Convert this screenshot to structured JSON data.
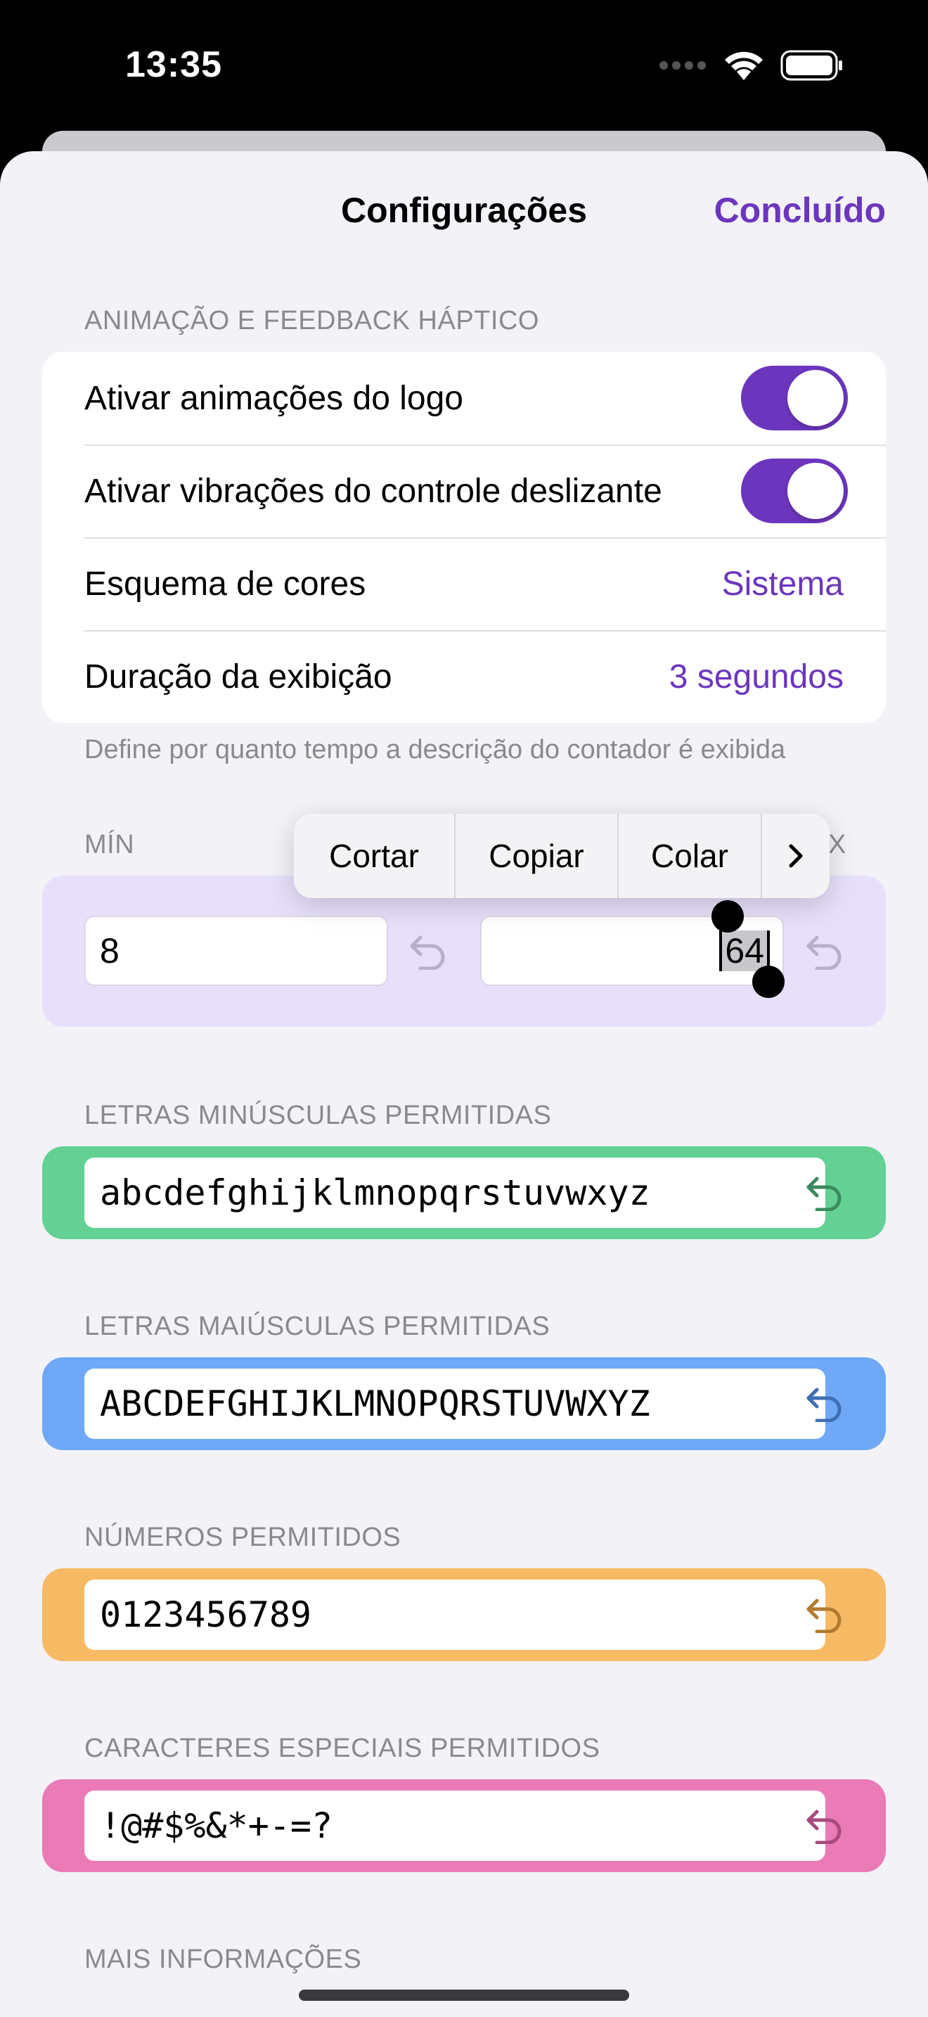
{
  "status_bar": {
    "time": "13:35"
  },
  "nav": {
    "title": "Configurações",
    "done_label": "Concluído"
  },
  "animation_section": {
    "header": "ANIMAÇÃO E FEEDBACK HÁPTICO",
    "rows": [
      {
        "label": "Ativar animações do logo",
        "toggle_on": true
      },
      {
        "label": "Ativar vibrações do controle deslizante",
        "toggle_on": true
      },
      {
        "label": "Esquema de cores",
        "value": "Sistema"
      },
      {
        "label": "Duração da exibição",
        "value": "3 segundos"
      }
    ],
    "footer": "Define por quanto tempo a descrição do contador é exibida"
  },
  "length_section": {
    "min_header": "MÍN",
    "max_header": "MÁX",
    "min_value": "8",
    "max_value": "64"
  },
  "context_menu": {
    "items": [
      "Cortar",
      "Copiar",
      "Colar"
    ]
  },
  "lowercase_section": {
    "header": "LETRAS MINÚSCULAS PERMITIDAS",
    "value": "abcdefghijklmnopqrstuvwxyz",
    "color": "#63d194"
  },
  "uppercase_section": {
    "header": "LETRAS MAIÚSCULAS PERMITIDAS",
    "value": "ABCDEFGHIJKLMNOPQRSTUVWXYZ",
    "color": "#6ea8f7"
  },
  "numbers_section": {
    "header": "NÚMEROS PERMITIDOS",
    "value": "0123456789",
    "color": "#f7ba64"
  },
  "special_section": {
    "header": "CARACTERES ESPECIAIS PERMITIDOS",
    "value": "!@#$%&*+-=?",
    "color": "#ea7bb7"
  },
  "more_section": {
    "header": "MAIS INFORMAÇÕES"
  },
  "colors": {
    "accent": "#6c35bd",
    "background": "#f2f2f7",
    "minmax_bg": "#e8e0fb"
  }
}
